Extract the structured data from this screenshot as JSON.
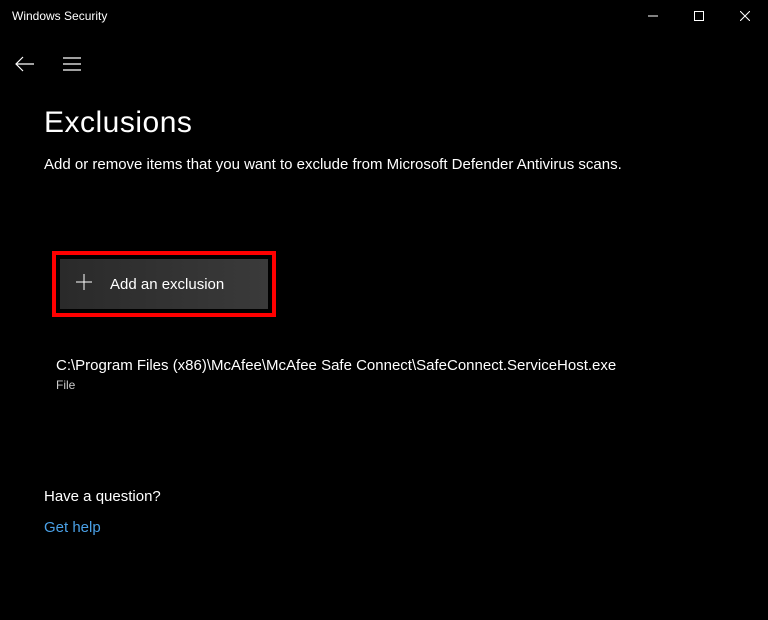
{
  "window": {
    "title": "Windows Security"
  },
  "page": {
    "title": "Exclusions",
    "description": "Add or remove items that you want to exclude from Microsoft Defender Antivirus scans."
  },
  "add_button": {
    "label": "Add an exclusion"
  },
  "exclusions": [
    {
      "path": "C:\\Program Files (x86)\\McAfee\\McAfee Safe Connect\\SafeConnect.ServiceHost.exe",
      "type": "File"
    }
  ],
  "help": {
    "heading": "Have a question?",
    "link_label": "Get help"
  }
}
